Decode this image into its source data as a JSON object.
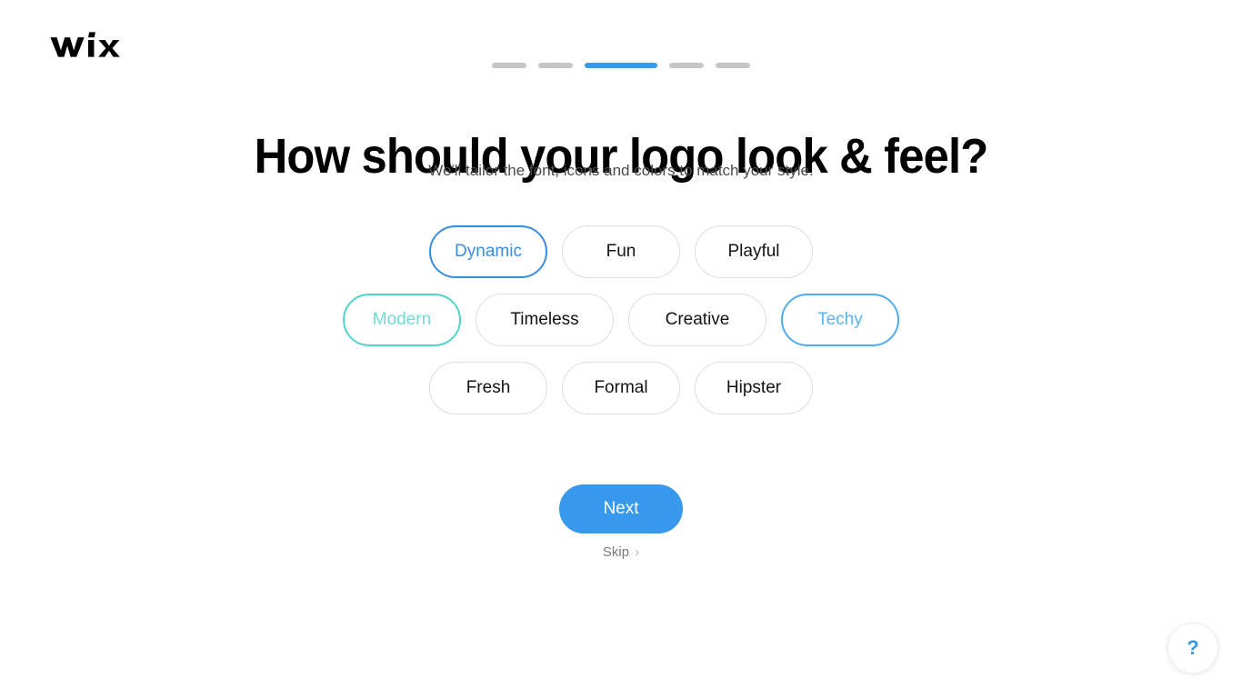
{
  "brand": {
    "logo_text": "WiX",
    "logo_color": "#000000",
    "accent_blue": "#3899ec"
  },
  "progress": {
    "total_steps": 5,
    "current_step": 3,
    "active_color": "#3899ec",
    "inactive_color": "#c3c7ca",
    "steps": [
      {
        "state": "inactive"
      },
      {
        "state": "inactive"
      },
      {
        "state": "active"
      },
      {
        "state": "inactive"
      },
      {
        "state": "inactive"
      }
    ]
  },
  "header": {
    "title": "How should your logo look & feel?",
    "subtitle": "We'll tailor the font, icons and colors to match your style."
  },
  "chips": {
    "rows": [
      [
        {
          "label": "Dynamic",
          "selected": true,
          "accent": "#3a8dde",
          "style": "sel-blue"
        },
        {
          "label": "Fun",
          "selected": false,
          "accent": "#dddddd",
          "style": ""
        },
        {
          "label": "Playful",
          "selected": false,
          "accent": "#dddddd",
          "style": ""
        }
      ],
      [
        {
          "label": "Modern",
          "selected": true,
          "accent": "#4fd4c8",
          "style": "sel-teal"
        },
        {
          "label": "Timeless",
          "selected": false,
          "accent": "#dddddd",
          "style": ""
        },
        {
          "label": "Creative",
          "selected": false,
          "accent": "#dddddd",
          "style": ""
        },
        {
          "label": "Techy",
          "selected": true,
          "accent": "#4fabf0",
          "style": "sel-sky"
        }
      ],
      [
        {
          "label": "Fresh",
          "selected": false,
          "accent": "#dddddd",
          "style": ""
        },
        {
          "label": "Formal",
          "selected": false,
          "accent": "#dddddd",
          "style": ""
        },
        {
          "label": "Hipster",
          "selected": false,
          "accent": "#dddddd",
          "style": ""
        }
      ]
    ]
  },
  "actions": {
    "next_label": "Next",
    "skip_label": "Skip",
    "skip_chevron": "›"
  },
  "help": {
    "icon_label": "?"
  }
}
